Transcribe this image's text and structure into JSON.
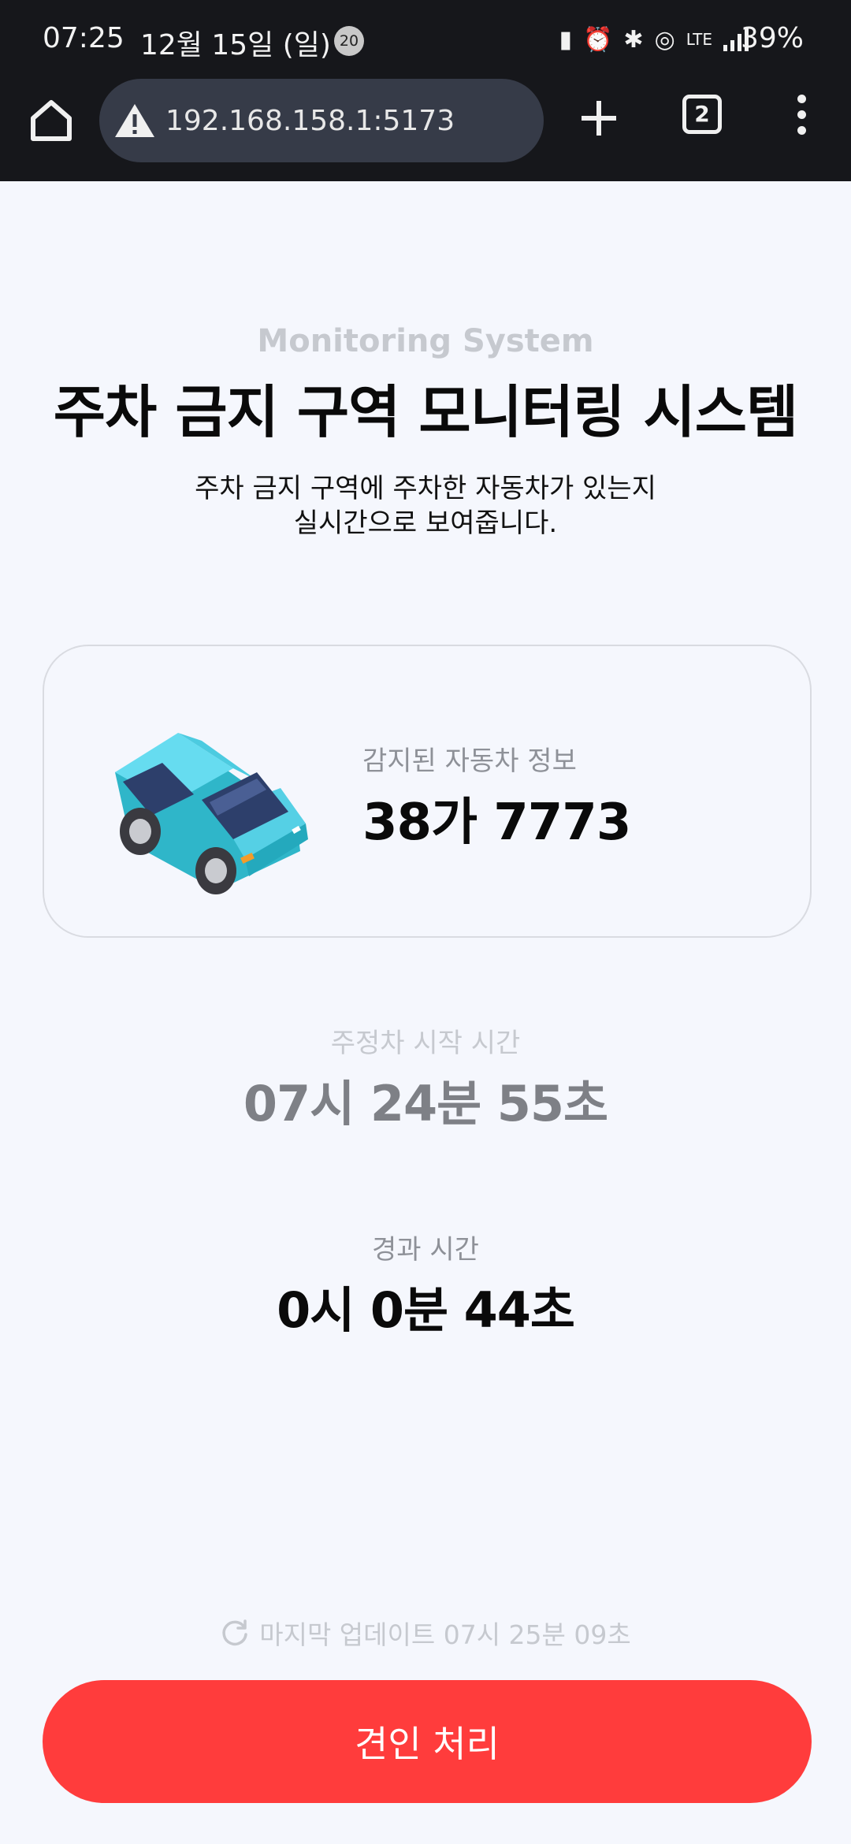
{
  "status_bar": {
    "time": "07:25",
    "date": "12월 15일 (일)",
    "notification_count": "20",
    "network": "LTE",
    "battery": "39%"
  },
  "browser": {
    "url": "192.168.158.1:5173",
    "tab_count": "2"
  },
  "page": {
    "subtitle": "Monitoring System",
    "title": "주차 금지 구역 모니터링 시스템",
    "description_line1": "주차 금지 구역에 주차한 자동차가 있는지",
    "description_line2": "실시간으로 보여줍니다.",
    "car_card": {
      "label": "감지된 자동차 정보",
      "plate": "38가 7773"
    },
    "start_time": {
      "label": "주정차 시작 시간",
      "value": "07시 24분 55초"
    },
    "elapsed_time": {
      "label": "경과 시간",
      "value": "0시 0분 44초"
    },
    "last_update": "마지막 업데이트 07시 25분 09초",
    "tow_button_label": "견인 처리"
  },
  "colors": {
    "accent_red": "#ff3c3c",
    "background": "#f5f7fd",
    "car_teal": "#3cc3d6"
  }
}
